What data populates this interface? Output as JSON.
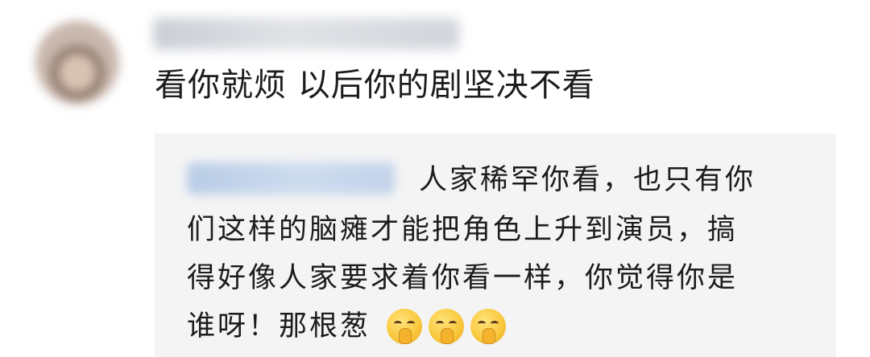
{
  "comment": {
    "text": "看你就烦 以后你的剧坚决不看"
  },
  "reply": {
    "lines": [
      "人家稀罕你看，也只有你",
      "们这样的脑瘫才能把角色上升到演员，搞",
      "得好像人家要求着你看一样，你觉得你是",
      "谁呀！那根葱"
    ],
    "emojis": [
      "shushing-face-icon",
      "shushing-face-icon",
      "shushing-face-icon"
    ]
  }
}
